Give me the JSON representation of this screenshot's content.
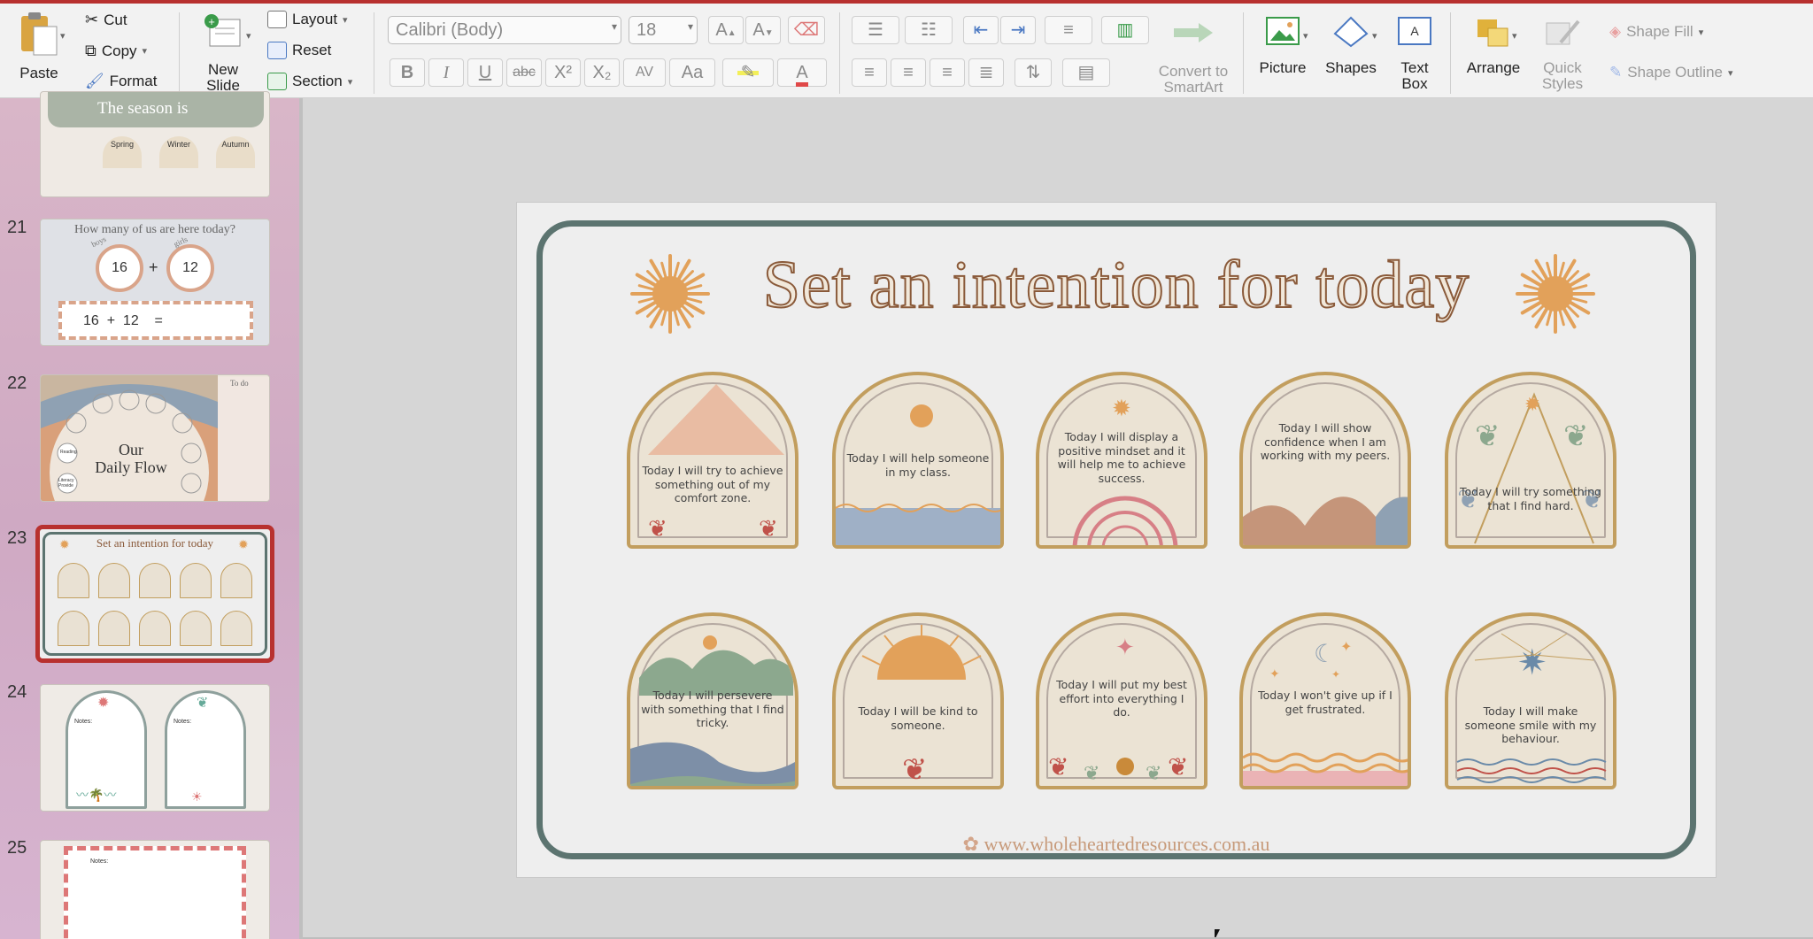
{
  "ribbon": {
    "paste": "Paste",
    "cut": "Cut",
    "copy": "Copy",
    "format": "Format",
    "new_slide": "New\nSlide",
    "layout": "Layout",
    "reset": "Reset",
    "section": "Section",
    "font_name": "Calibri (Body)",
    "font_size": "18",
    "bold": "B",
    "italic": "I",
    "underline": "U",
    "strike": "abc",
    "superscript": "X²",
    "subscript": "X₂",
    "char_spacing": "AV",
    "change_case": "Aa",
    "font_color": "A",
    "grow_font": "A",
    "shrink_font": "A",
    "convert_smartart": "Convert to\nSmartArt",
    "picture": "Picture",
    "shapes": "Shapes",
    "text_box": "Text\nBox",
    "arrange": "Arrange",
    "quick_styles": "Quick\nStyles",
    "shape_fill": "Shape Fill",
    "shape_outline": "Shape Outline"
  },
  "thumbnails": [
    {
      "number": "",
      "title": "The season is",
      "labels": [
        "Spring",
        "Winter",
        "Autumn"
      ]
    },
    {
      "number": "21",
      "title": "How many of us are here today?",
      "boys_label": "boys",
      "girls_label": "girls",
      "boys": "16",
      "girls": "12",
      "sum": "16  +  12    ="
    },
    {
      "number": "22",
      "title": "Our\nDaily Flow",
      "todo": "To do",
      "reading": "Reading",
      "literacy": "Literacy\nProvide"
    },
    {
      "number": "23",
      "title": "Set an intention for today"
    },
    {
      "number": "24",
      "notes_a": "Notes:",
      "notes_b": "Notes:"
    },
    {
      "number": "25",
      "notes": "Notes:"
    }
  ],
  "slide": {
    "title": "Set an intention for today",
    "url": "www.wholeheartedresources.com.au",
    "cards": [
      "Today I will try to achieve something out of my comfort zone.",
      "Today I will help someone in my class.",
      "Today I will display a positive mindset and it will help me to achieve success.",
      "Today I will show confidence when I am working with my peers.",
      "Today I will try something that I find hard.",
      "Today I will persevere with something that I find tricky.",
      "Today I will be kind to someone.",
      "Today I will put my best effort into everything I do.",
      "Today I won't give up if I get frustrated.",
      "Today I will make someone smile with my behaviour."
    ]
  },
  "colors": {
    "accent_red": "#b8312f",
    "frame_teal": "#5c7470",
    "card_border_gold": "#c29e5e",
    "sun_orange": "#e2a15a",
    "title_brown": "#8a5a3a"
  }
}
